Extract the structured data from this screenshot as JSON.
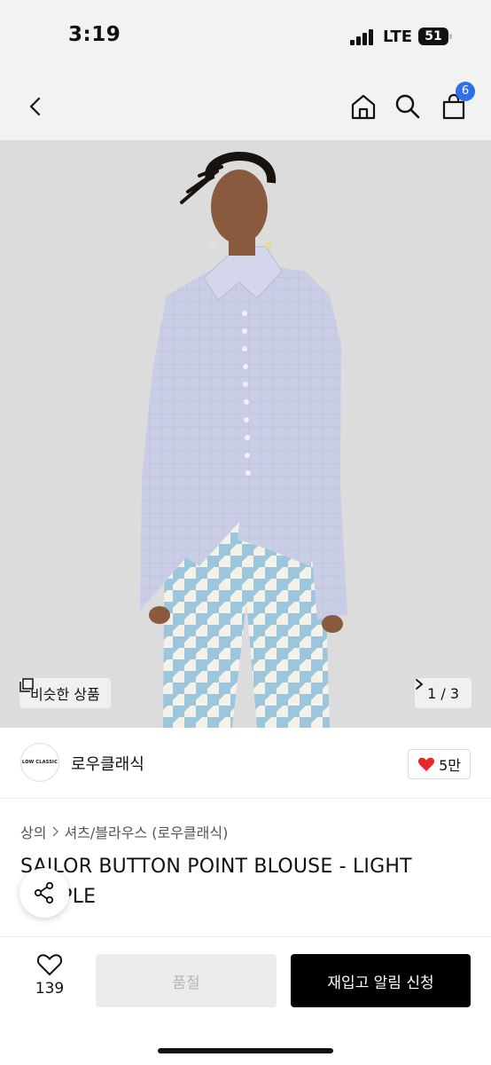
{
  "status_bar": {
    "time": "3:19",
    "network": "LTE",
    "battery": "51"
  },
  "nav": {
    "cart_count": "6",
    "icons": [
      "back-icon",
      "home-icon",
      "search-icon",
      "cart-icon"
    ]
  },
  "hero": {
    "similar_label": "비슷한 상품",
    "page_indicator": "1 / 3",
    "colors": {
      "background": "#dcdcdc",
      "shirt": "#c9cde6",
      "pants": "#a9cbe0"
    }
  },
  "brand": {
    "logo_text": "LOW CLASSIC",
    "name": "로우클래식",
    "likes": "5만"
  },
  "breadcrumb": {
    "category": "상의",
    "subcategory": "셔츠/블라우스 (로우클래식)"
  },
  "product": {
    "title": "SAILOR BUTTON POINT BLOUSE - LIGHT PURPLE"
  },
  "bottom": {
    "wish_count": "139",
    "soldout_label": "품절",
    "restock_label": "재입고 알림 신청"
  },
  "colors": {
    "accent": "#2f6fe8",
    "heart": "#e8262d",
    "primary_button": "#000000"
  }
}
